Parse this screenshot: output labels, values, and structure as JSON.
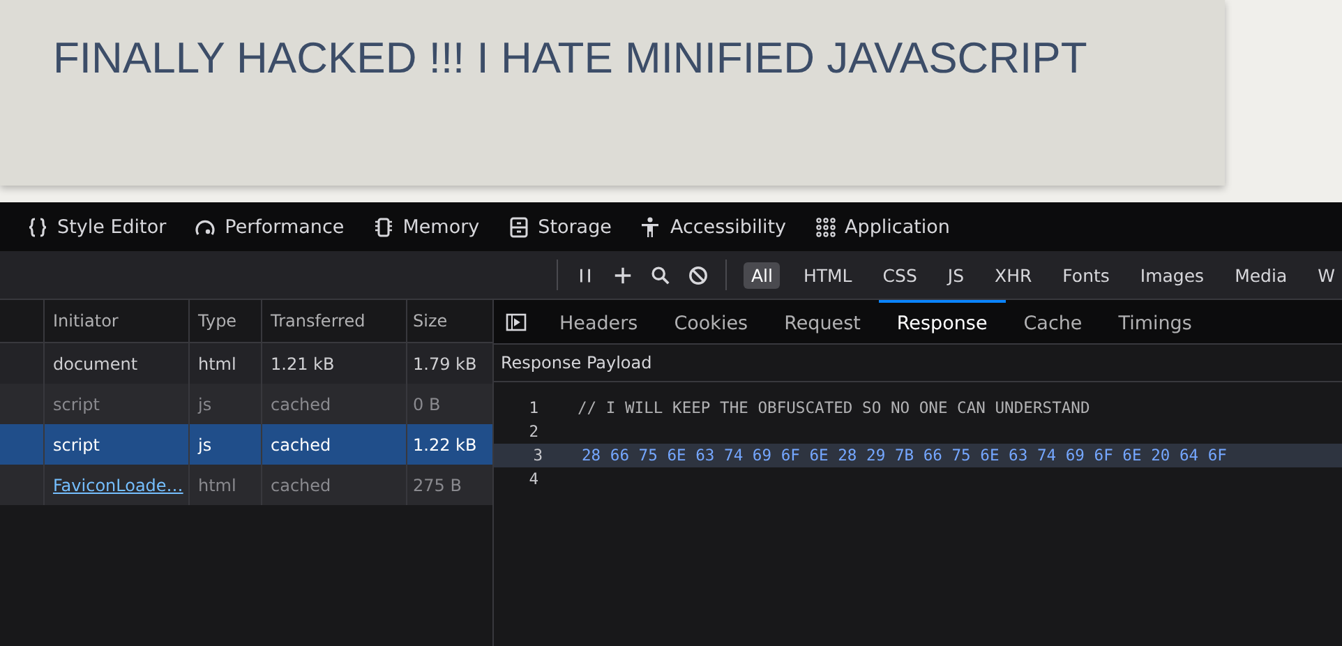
{
  "page": {
    "heading": "FINALLY HACKED !!! I HATE MINIFIED JAVASCRIPT"
  },
  "devtools_tabs": [
    {
      "label": "Style Editor"
    },
    {
      "label": "Performance"
    },
    {
      "label": "Memory"
    },
    {
      "label": "Storage"
    },
    {
      "label": "Accessibility"
    },
    {
      "label": "Application"
    }
  ],
  "toolbar": {
    "filters": [
      {
        "label": "All",
        "selected": true
      },
      {
        "label": "HTML",
        "selected": false
      },
      {
        "label": "CSS",
        "selected": false
      },
      {
        "label": "JS",
        "selected": false
      },
      {
        "label": "XHR",
        "selected": false
      },
      {
        "label": "Fonts",
        "selected": false
      },
      {
        "label": "Images",
        "selected": false
      },
      {
        "label": "Media",
        "selected": false
      },
      {
        "label": "W",
        "selected": false
      }
    ]
  },
  "table": {
    "columns": [
      "Initiator",
      "Type",
      "Transferred",
      "Size"
    ],
    "rows": [
      {
        "initiator": "document",
        "link": false,
        "type": "html",
        "transferred": "1.21 kB",
        "size": "1.79 kB",
        "cached": false,
        "selected": false
      },
      {
        "initiator": "script",
        "link": false,
        "type": "js",
        "transferred": "cached",
        "size": "0 B",
        "cached": true,
        "selected": false
      },
      {
        "initiator": "script",
        "link": false,
        "type": "js",
        "transferred": "cached",
        "size": "1.22 kB",
        "cached": true,
        "selected": true
      },
      {
        "initiator": "FaviconLoade…",
        "link": true,
        "type": "html",
        "transferred": "cached",
        "size": "275 B",
        "cached": true,
        "selected": false
      }
    ]
  },
  "details": {
    "tabs": [
      {
        "label": "Headers",
        "selected": false
      },
      {
        "label": "Cookies",
        "selected": false
      },
      {
        "label": "Request",
        "selected": false
      },
      {
        "label": "Response",
        "selected": true
      },
      {
        "label": "Cache",
        "selected": false
      },
      {
        "label": "Timings",
        "selected": false
      }
    ],
    "section_title": "Response Payload",
    "lines": [
      {
        "number": "1",
        "text": "// I WILL KEEP THE OBFUSCATED SO NO ONE CAN UNDERSTAND",
        "kind": "comment",
        "selected": false
      },
      {
        "number": "2",
        "kind": "blank",
        "selected": false
      },
      {
        "number": "3",
        "text": "28 66 75 6E 63 74 69 6F 6E 28 29 7B 66 75 6E 63 74 69 6F 6E 20 64 6F",
        "kind": "code",
        "selected": true
      },
      {
        "number": "4",
        "kind": "blank",
        "selected": false
      }
    ]
  }
}
